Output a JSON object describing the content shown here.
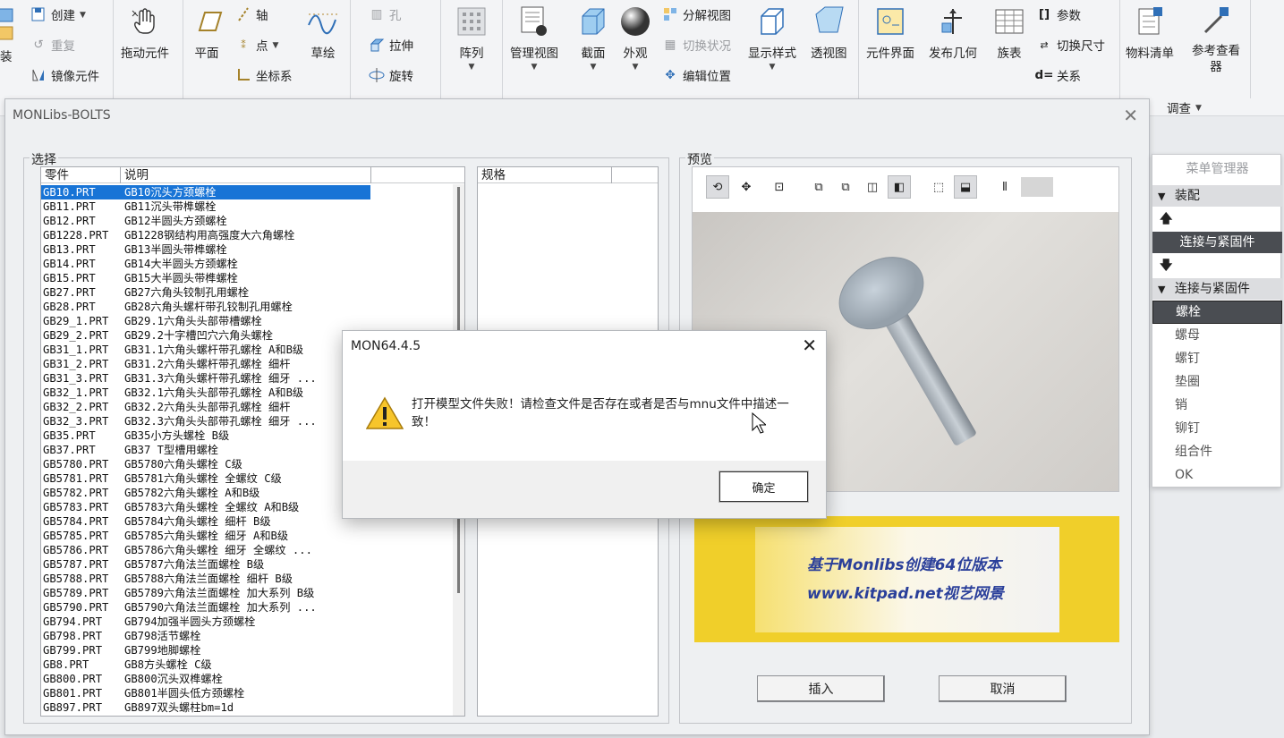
{
  "ribbon": {
    "left_edge_label": "装",
    "create": "创建",
    "redo": "重复",
    "mirror": "镜像元件",
    "drag": "拖动元件",
    "plane": "平面",
    "axis": "轴",
    "point": "点",
    "csys": "坐标系",
    "sketch": "草绘",
    "hole": "孔",
    "extrude": "拉伸",
    "revolve": "旋转",
    "pattern": "阵列",
    "manage_view": "管理视图",
    "section": "截面",
    "appearance": "外观",
    "explode_view": "分解视图",
    "toggle_status": "切换状况",
    "edit_position": "编辑位置",
    "display_style": "显示样式",
    "perspective": "透视图",
    "component_interface": "元件界面",
    "publish_geom": "发布几何",
    "family_table": "族表",
    "params": "参数",
    "switch_dims": "切换尺寸",
    "relations": "关系",
    "bom": "物料清单",
    "ref_viewer": "参考查看器",
    "investigate": "调查"
  },
  "window": {
    "title": "MONLibs-BOLTS",
    "select_group": "选择",
    "col_part": "零件",
    "col_desc": "说明",
    "spec_header": "规格",
    "preview_group": "预览",
    "insert": "插入",
    "cancel": "取消"
  },
  "parts": [
    [
      "GB10.PRT",
      "GB10沉头方颈螺栓"
    ],
    [
      "GB11.PRT",
      "GB11沉头带榫螺栓"
    ],
    [
      "GB12.PRT",
      "GB12半圆头方颈螺栓"
    ],
    [
      "GB1228.PRT",
      "GB1228钢结构用高强度大六角螺栓"
    ],
    [
      "GB13.PRT",
      "GB13半圆头带榫螺栓"
    ],
    [
      "GB14.PRT",
      "GB14大半圆头方颈螺栓"
    ],
    [
      "GB15.PRT",
      "GB15大半圆头带榫螺栓"
    ],
    [
      "GB27.PRT",
      "GB27六角头铰制孔用螺栓"
    ],
    [
      "GB28.PRT",
      "GB28六角头螺杆带孔铰制孔用螺栓"
    ],
    [
      "GB29_1.PRT",
      "GB29.1六角头头部带槽螺栓"
    ],
    [
      "GB29_2.PRT",
      "GB29.2十字槽凹穴六角头螺栓"
    ],
    [
      "GB31_1.PRT",
      "GB31.1六角头螺杆带孔螺栓  A和B级"
    ],
    [
      "GB31_2.PRT",
      "GB31.2六角头螺杆带孔螺栓  细杆"
    ],
    [
      "GB31_3.PRT",
      "GB31.3六角头螺杆带孔螺栓  细牙 ..."
    ],
    [
      "GB32_1.PRT",
      "GB32.1六角头头部带孔螺栓  A和B级"
    ],
    [
      "GB32_2.PRT",
      "GB32.2六角头头部带孔螺栓  细杆"
    ],
    [
      "GB32_3.PRT",
      "GB32.3六角头头部带孔螺栓  细牙 ..."
    ],
    [
      "GB35.PRT",
      "GB35小方头螺栓  B级"
    ],
    [
      "GB37.PRT",
      "GB37 T型槽用螺栓"
    ],
    [
      "GB5780.PRT",
      "GB5780六角头螺栓  C级"
    ],
    [
      "GB5781.PRT",
      "GB5781六角头螺栓  全螺纹  C级"
    ],
    [
      "GB5782.PRT",
      "GB5782六角头螺栓  A和B级"
    ],
    [
      "GB5783.PRT",
      "GB5783六角头螺栓  全螺纹  A和B级"
    ],
    [
      "GB5784.PRT",
      "GB5784六角头螺栓  细杆  B级"
    ],
    [
      "GB5785.PRT",
      "GB5785六角头螺栓  细牙  A和B级"
    ],
    [
      "GB5786.PRT",
      "GB5786六角头螺栓  细牙  全螺纹 ..."
    ],
    [
      "GB5787.PRT",
      "GB5787六角法兰面螺栓  B级"
    ],
    [
      "GB5788.PRT",
      "GB5788六角法兰面螺栓  细杆  B级"
    ],
    [
      "GB5789.PRT",
      "GB5789六角法兰面螺栓  加大系列  B级"
    ],
    [
      "GB5790.PRT",
      "GB5790六角法兰面螺栓  加大系列 ..."
    ],
    [
      "GB794.PRT",
      "GB794加强半圆头方颈螺栓"
    ],
    [
      "GB798.PRT",
      "GB798活节螺栓"
    ],
    [
      "GB799.PRT",
      "GB799地脚螺栓"
    ],
    [
      "GB8.PRT",
      "GB8方头螺栓  C级"
    ],
    [
      "GB800.PRT",
      "GB800沉头双榫螺栓"
    ],
    [
      "GB801.PRT",
      "GB801半圆头低方颈螺栓"
    ],
    [
      "GB897.PRT",
      "GB897双头螺柱bm=1d"
    ]
  ],
  "banner": {
    "line1": "基于Monlibs创建64位版本",
    "line2": "www.kitpad.net视艺网景"
  },
  "menu_manager": {
    "title": "菜单管理器",
    "assembly": "装配",
    "connect_btn": "连接与紧固件",
    "connect_header": "连接与紧固件",
    "items": [
      "螺栓",
      "螺母",
      "螺钉",
      "垫圈",
      "销",
      "铆钉",
      "组合件",
      "OK"
    ]
  },
  "dialog": {
    "title": "MON64.4.5",
    "message": "打开模型文件失败！请检查文件是否存在或者是否与mnu文件中描述一致！",
    "ok": "确定"
  },
  "colors": {
    "selection": "#1874d6",
    "banner_yellow": "#f0cf2a",
    "banner_text": "#2a3f9a"
  }
}
